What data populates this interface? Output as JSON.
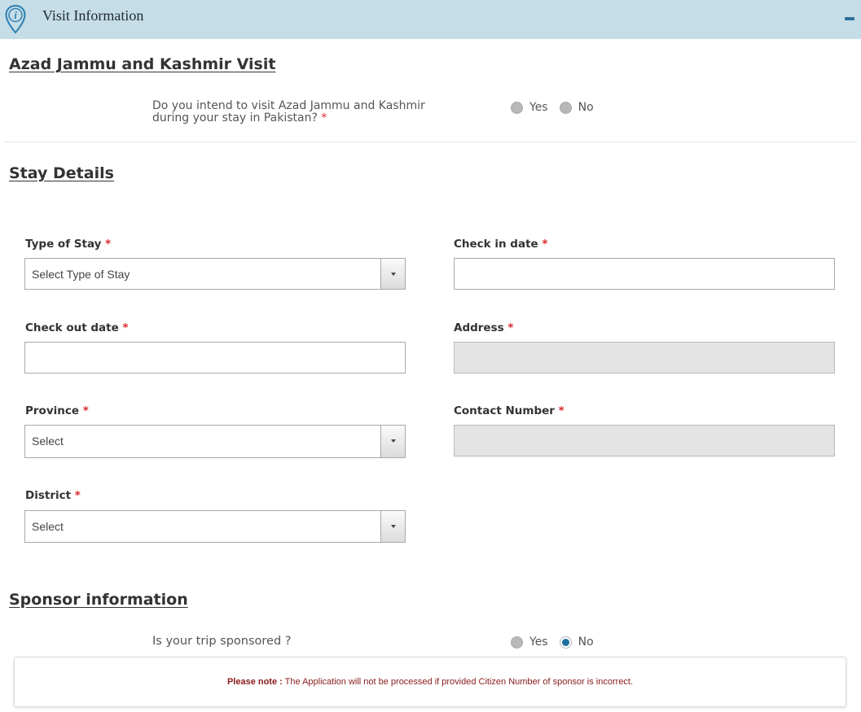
{
  "header": {
    "title": "Visit Information",
    "icon": "info-pin-icon",
    "collapse_icon": "minus-icon",
    "background": "#c5dde6"
  },
  "ajk_section": {
    "title": "Azad Jammu and Kashmir Visit",
    "question_line1": "Do you intend to visit Azad Jammu and Kashmir",
    "question_line2": "during your stay in Pakistan?",
    "required_mark": "*",
    "options": [
      {
        "label": "Yes",
        "checked": false
      },
      {
        "label": "No",
        "checked": false
      }
    ]
  },
  "stay_section": {
    "title": "Stay Details",
    "required_mark": "*",
    "fields": {
      "type_of_stay": {
        "label": "Type of Stay",
        "value": "Select Type of Stay"
      },
      "check_in": {
        "label": "Check in date",
        "value": ""
      },
      "check_out": {
        "label": "Check out date",
        "value": ""
      },
      "address": {
        "label": "Address",
        "value": ""
      },
      "province": {
        "label": "Province",
        "value": "Select"
      },
      "contact": {
        "label": "Contact Number",
        "value": ""
      },
      "district": {
        "label": "District",
        "value": "Select"
      }
    }
  },
  "sponsor_section": {
    "title": "Sponsor information",
    "question": "Is your trip sponsored ?",
    "options": [
      {
        "label": "Yes",
        "checked": false
      },
      {
        "label": "No",
        "checked": true
      }
    ],
    "note_prefix": "Please note :",
    "note_text": " The Application will not be processed if provided Citizen Number of sponsor is incorrect."
  },
  "colors": {
    "accent": "#1e6fa0",
    "required": "#d9262c",
    "note_text": "#8a1b1b"
  }
}
